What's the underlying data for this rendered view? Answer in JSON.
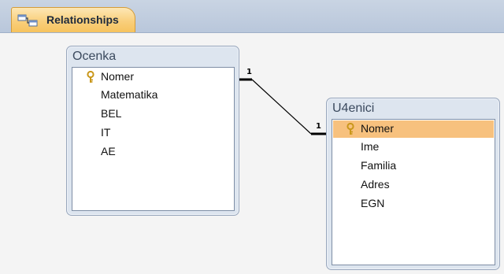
{
  "tab": {
    "icon": "relationships-icon",
    "label": "Relationships"
  },
  "tables": [
    {
      "title": "Ocenka",
      "fields": [
        {
          "name": "Nomer",
          "primary_key": true
        },
        {
          "name": "Matematika",
          "primary_key": false
        },
        {
          "name": "BEL",
          "primary_key": false
        },
        {
          "name": "IT",
          "primary_key": false
        },
        {
          "name": "AE",
          "primary_key": false
        }
      ]
    },
    {
      "title": "U4enici",
      "selected_field": "Nomer",
      "fields": [
        {
          "name": "Nomer",
          "primary_key": true
        },
        {
          "name": "Ime",
          "primary_key": false
        },
        {
          "name": "Familia",
          "primary_key": false
        },
        {
          "name": "Adres",
          "primary_key": false
        },
        {
          "name": "EGN",
          "primary_key": false
        }
      ]
    }
  ],
  "relationship": {
    "from_table": "Ocenka",
    "from_field": "Nomer",
    "to_table": "U4enici",
    "to_field": "Nomer",
    "from_cardinality": "1",
    "to_cardinality": "1"
  },
  "colors": {
    "tab_accent": "#f6c35e",
    "selected_row": "#f7c17e",
    "key_icon": "#d9a520"
  }
}
